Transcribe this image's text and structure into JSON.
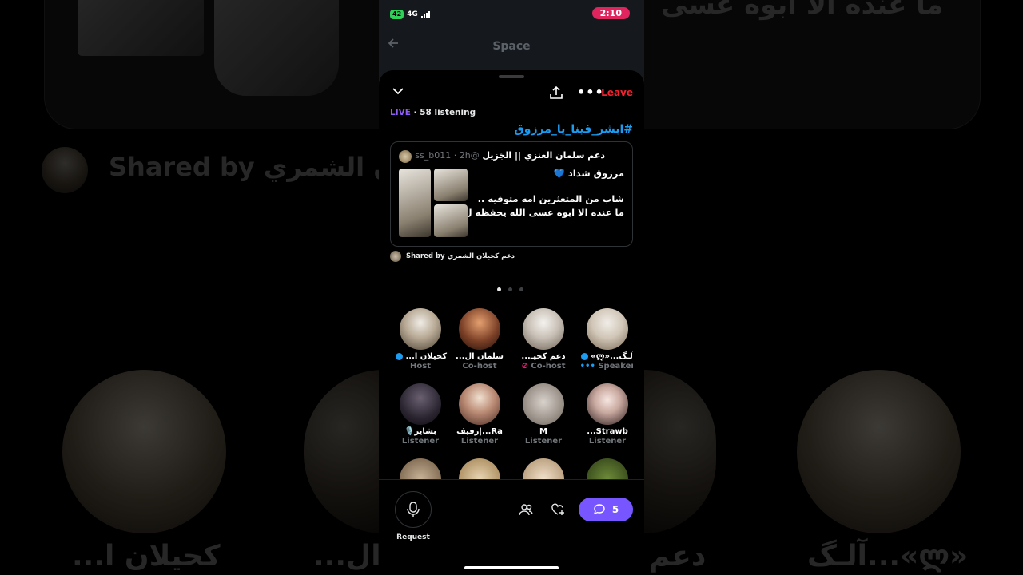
{
  "background": {
    "shared_by_text": "Shared by دعم كحيلان الشمري",
    "tweet_fragment": "ما عنده الا ابوه عسى",
    "names": [
      "كحيلان ا...",
      "سلمان ال...",
      "دعم",
      "آلـگ...«ლ»"
    ]
  },
  "status_bar": {
    "battery": "42",
    "network": "4G",
    "time": "2:10"
  },
  "topbar": {
    "title": "Space"
  },
  "space": {
    "leave_label": "Leave",
    "live_label": "LIVE",
    "listening": " · 58 listening",
    "title": "#ابشر_فينا_يا_مرزوق"
  },
  "tweet": {
    "author": "دعم سلمان العنزي || الجَزيل",
    "handle_time": "@ss_b011 · 2h",
    "line1": "مرزوق شداد 💙",
    "line2": "شاب من المتعثرين  امه متوفيه ..",
    "line3": "ما عنده الا ابوه عسى الله يحفظه ل..."
  },
  "shared_by": "Shared by دعم كحيلان الشمري",
  "participants": [
    {
      "name": "كحيلان ا...",
      "role": "Host",
      "verified": true
    },
    {
      "name": "سلمان ال...",
      "role": "Co-host",
      "verified": false
    },
    {
      "name": "دعم كحيـ...",
      "role": "Co-host",
      "verified": false,
      "muted": true
    },
    {
      "name": "آلـگ...«ლ»",
      "role": "Speaker",
      "verified": true
    },
    {
      "name": "بشاير🎙️",
      "role": "Listener"
    },
    {
      "name": "Ra...|رفيف",
      "role": "Listener"
    },
    {
      "name": "M",
      "role": "Listener"
    },
    {
      "name": "Strawb...",
      "role": "Listener"
    }
  ],
  "bottom": {
    "request_label": "Request",
    "comment_count": "5"
  },
  "colors": {
    "accent": "#7856ff",
    "live": "#8b5cf6",
    "leave": "#f4212e",
    "link": "#1d9bf0"
  }
}
